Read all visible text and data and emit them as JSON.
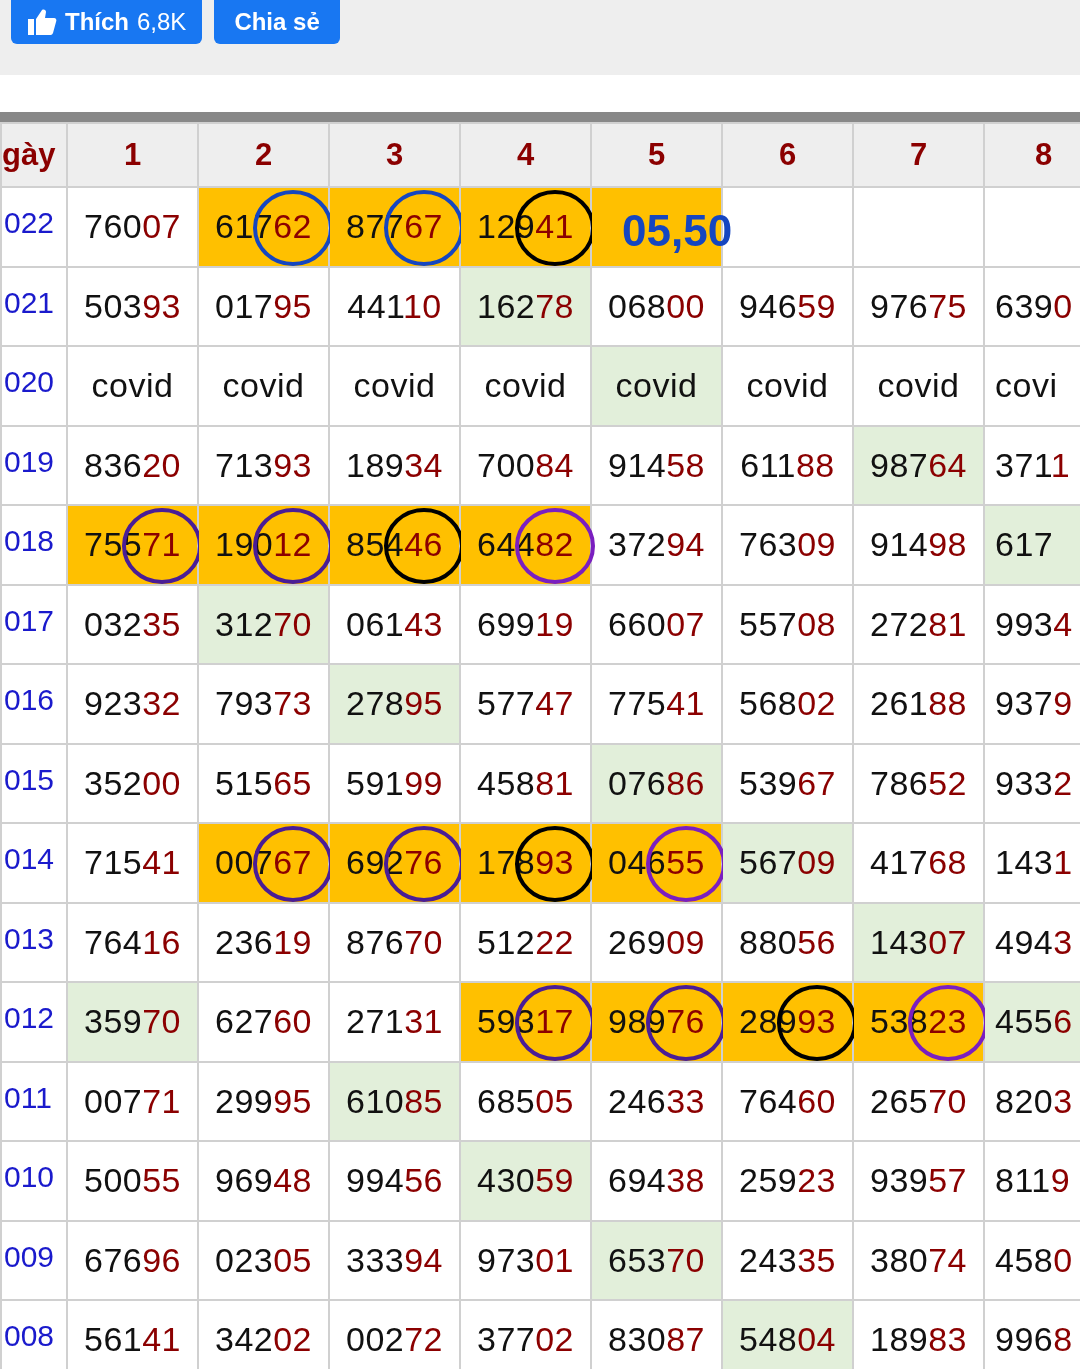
{
  "share_bar": {
    "like_button": {
      "label": "Thích",
      "count": "6,8K"
    },
    "share_button": {
      "label": "Chia sẻ"
    }
  },
  "table": {
    "columns": [
      "gày",
      "1",
      "2",
      "3",
      "4",
      "5",
      "6",
      "7",
      "8"
    ],
    "rows": [
      {
        "cells": [
          {
            "kind": "date",
            "text": "022"
          },
          {
            "kind": "number",
            "text": "76007"
          },
          {
            "kind": "number",
            "text": "61762",
            "color": "#ffc000",
            "circle": {
              "color": "#1546c0"
            }
          },
          {
            "kind": "number",
            "text": "87767",
            "color": "#ffc000",
            "circle": {
              "color": "#1546c0"
            }
          },
          {
            "kind": "number",
            "text": "12941",
            "color": "#ffc000",
            "circle": {
              "color": "#000000"
            }
          },
          {
            "kind": "note",
            "text": "05,50",
            "color": "#ffc000"
          },
          {
            "kind": "empty"
          },
          {
            "kind": "empty"
          },
          {
            "kind": "empty"
          }
        ]
      },
      {
        "cells": [
          {
            "kind": "date",
            "text": "021"
          },
          {
            "kind": "number",
            "text": "50393"
          },
          {
            "kind": "number",
            "text": "01795"
          },
          {
            "kind": "number",
            "text": "44110"
          },
          {
            "kind": "number",
            "text": "16278",
            "color": "#e2efda"
          },
          {
            "kind": "number",
            "text": "06800"
          },
          {
            "kind": "number",
            "text": "94659"
          },
          {
            "kind": "number",
            "text": "97675"
          },
          {
            "kind": "number",
            "text": "6390"
          }
        ]
      },
      {
        "cells": [
          {
            "kind": "date",
            "text": "020"
          },
          {
            "kind": "text",
            "text": "covid"
          },
          {
            "kind": "text",
            "text": "covid"
          },
          {
            "kind": "text",
            "text": "covid"
          },
          {
            "kind": "text",
            "text": "covid"
          },
          {
            "kind": "text",
            "text": "covid",
            "color": "#e2efda"
          },
          {
            "kind": "text",
            "text": "covid"
          },
          {
            "kind": "text",
            "text": "covid"
          },
          {
            "kind": "text",
            "text": "covi"
          }
        ]
      },
      {
        "cells": [
          {
            "kind": "date",
            "text": "019"
          },
          {
            "kind": "number",
            "text": "83620"
          },
          {
            "kind": "number",
            "text": "71393"
          },
          {
            "kind": "number",
            "text": "18934"
          },
          {
            "kind": "number",
            "text": "70084"
          },
          {
            "kind": "number",
            "text": "91458"
          },
          {
            "kind": "number",
            "text": "61188"
          },
          {
            "kind": "number",
            "text": "98764",
            "color": "#e2efda"
          },
          {
            "kind": "number",
            "text": "3711"
          }
        ]
      },
      {
        "cells": [
          {
            "kind": "date",
            "text": "018"
          },
          {
            "kind": "number",
            "text": "75571",
            "color": "#ffc000",
            "circle": {
              "color": "#4a1d96"
            }
          },
          {
            "kind": "number",
            "text": "19012",
            "color": "#ffc000",
            "circle": {
              "color": "#4a1d96"
            }
          },
          {
            "kind": "number",
            "text": "85446",
            "color": "#ffc000",
            "circle": {
              "color": "#000000"
            }
          },
          {
            "kind": "number",
            "text": "64482",
            "color": "#ffc000",
            "circle": {
              "color": "#7a1fc0"
            }
          },
          {
            "kind": "number",
            "text": "37294"
          },
          {
            "kind": "number",
            "text": "76309"
          },
          {
            "kind": "number",
            "text": "91498"
          },
          {
            "kind": "number",
            "text": "617",
            "color": "#e2efda"
          }
        ]
      },
      {
        "cells": [
          {
            "kind": "date",
            "text": "017"
          },
          {
            "kind": "number",
            "text": "03235"
          },
          {
            "kind": "number",
            "text": "31270",
            "color": "#e2efda"
          },
          {
            "kind": "number",
            "text": "06143"
          },
          {
            "kind": "number",
            "text": "69919"
          },
          {
            "kind": "number",
            "text": "66007"
          },
          {
            "kind": "number",
            "text": "55708"
          },
          {
            "kind": "number",
            "text": "27281"
          },
          {
            "kind": "number",
            "text": "9934"
          }
        ]
      },
      {
        "cells": [
          {
            "kind": "date",
            "text": "016"
          },
          {
            "kind": "number",
            "text": "92332"
          },
          {
            "kind": "number",
            "text": "79373"
          },
          {
            "kind": "number",
            "text": "27895",
            "color": "#e2efda"
          },
          {
            "kind": "number",
            "text": "57747"
          },
          {
            "kind": "number",
            "text": "77541"
          },
          {
            "kind": "number",
            "text": "56802"
          },
          {
            "kind": "number",
            "text": "26188"
          },
          {
            "kind": "number",
            "text": "9379"
          }
        ]
      },
      {
        "cells": [
          {
            "kind": "date",
            "text": "015"
          },
          {
            "kind": "number",
            "text": "35200"
          },
          {
            "kind": "number",
            "text": "51565"
          },
          {
            "kind": "number",
            "text": "59199"
          },
          {
            "kind": "number",
            "text": "45881"
          },
          {
            "kind": "number",
            "text": "07686",
            "color": "#e2efda"
          },
          {
            "kind": "number",
            "text": "53967"
          },
          {
            "kind": "number",
            "text": "78652"
          },
          {
            "kind": "number",
            "text": "9332"
          }
        ]
      },
      {
        "cells": [
          {
            "kind": "date",
            "text": "014"
          },
          {
            "kind": "number",
            "text": "71541"
          },
          {
            "kind": "number",
            "text": "00767",
            "color": "#ffc000",
            "circle": {
              "color": "#4a1d96"
            }
          },
          {
            "kind": "number",
            "text": "69276",
            "color": "#ffc000",
            "circle": {
              "color": "#4a1d96"
            }
          },
          {
            "kind": "number",
            "text": "17893",
            "color": "#ffc000",
            "circle": {
              "color": "#000000"
            }
          },
          {
            "kind": "number",
            "text": "04655",
            "color": "#ffc000",
            "circle": {
              "color": "#7a1fc0"
            }
          },
          {
            "kind": "number",
            "text": "56709",
            "color": "#e2efda"
          },
          {
            "kind": "number",
            "text": "41768"
          },
          {
            "kind": "number",
            "text": "1431"
          }
        ]
      },
      {
        "cells": [
          {
            "kind": "date",
            "text": "013"
          },
          {
            "kind": "number",
            "text": "76416"
          },
          {
            "kind": "number",
            "text": "23619"
          },
          {
            "kind": "number",
            "text": "87670"
          },
          {
            "kind": "number",
            "text": "51222"
          },
          {
            "kind": "number",
            "text": "26909"
          },
          {
            "kind": "number",
            "text": "88056"
          },
          {
            "kind": "number",
            "text": "14307",
            "color": "#e2efda"
          },
          {
            "kind": "number",
            "text": "4943"
          }
        ]
      },
      {
        "cells": [
          {
            "kind": "date",
            "text": "012"
          },
          {
            "kind": "number",
            "text": "35970",
            "color": "#e2efda"
          },
          {
            "kind": "number",
            "text": "62760"
          },
          {
            "kind": "number",
            "text": "27131"
          },
          {
            "kind": "number",
            "text": "59317",
            "color": "#ffc000",
            "circle": {
              "color": "#4a1d96"
            }
          },
          {
            "kind": "number",
            "text": "98976",
            "color": "#ffc000",
            "circle": {
              "color": "#4a1d96"
            }
          },
          {
            "kind": "number",
            "text": "28993",
            "color": "#ffc000",
            "circle": {
              "color": "#000000"
            }
          },
          {
            "kind": "number",
            "text": "53823",
            "color": "#ffc000",
            "circle": {
              "color": "#7a1fc0"
            }
          },
          {
            "kind": "number",
            "text": "4556",
            "color": "#e2efda"
          }
        ]
      },
      {
        "cells": [
          {
            "kind": "date",
            "text": "011"
          },
          {
            "kind": "number",
            "text": "00771"
          },
          {
            "kind": "number",
            "text": "29995"
          },
          {
            "kind": "number",
            "text": "61085",
            "color": "#e2efda"
          },
          {
            "kind": "number",
            "text": "68505"
          },
          {
            "kind": "number",
            "text": "24633"
          },
          {
            "kind": "number",
            "text": "76460"
          },
          {
            "kind": "number",
            "text": "26570"
          },
          {
            "kind": "number",
            "text": "8203"
          }
        ]
      },
      {
        "cells": [
          {
            "kind": "date",
            "text": "010"
          },
          {
            "kind": "number",
            "text": "50055"
          },
          {
            "kind": "number",
            "text": "96948"
          },
          {
            "kind": "number",
            "text": "99456"
          },
          {
            "kind": "number",
            "text": "43059",
            "color": "#e2efda"
          },
          {
            "kind": "number",
            "text": "69438"
          },
          {
            "kind": "number",
            "text": "25923"
          },
          {
            "kind": "number",
            "text": "93957"
          },
          {
            "kind": "number",
            "text": "8119"
          }
        ]
      },
      {
        "cells": [
          {
            "kind": "date",
            "text": "009"
          },
          {
            "kind": "number",
            "text": "67696"
          },
          {
            "kind": "number",
            "text": "02305"
          },
          {
            "kind": "number",
            "text": "33394"
          },
          {
            "kind": "number",
            "text": "97301"
          },
          {
            "kind": "number",
            "text": "65370",
            "color": "#e2efda"
          },
          {
            "kind": "number",
            "text": "24335"
          },
          {
            "kind": "number",
            "text": "38074"
          },
          {
            "kind": "number",
            "text": "4580"
          }
        ]
      },
      {
        "cells": [
          {
            "kind": "date",
            "text": "008"
          },
          {
            "kind": "number",
            "text": "56141"
          },
          {
            "kind": "number",
            "text": "34202"
          },
          {
            "kind": "number",
            "text": "00272"
          },
          {
            "kind": "number",
            "text": "37702"
          },
          {
            "kind": "number",
            "text": "83087"
          },
          {
            "kind": "number",
            "text": "54804",
            "color": "#e2efda"
          },
          {
            "kind": "number",
            "text": "18983"
          },
          {
            "kind": "number",
            "text": "9968"
          }
        ]
      }
    ]
  }
}
